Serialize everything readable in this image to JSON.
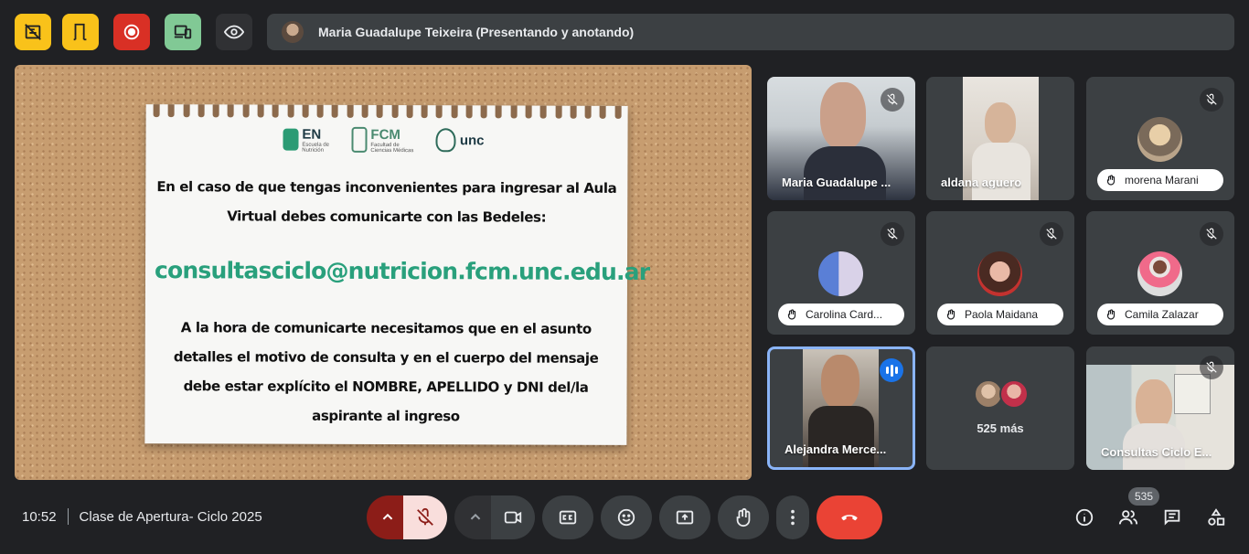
{
  "topbar": {
    "presenter_label": "Maria Guadalupe Teixeira (Presentando y anotando)",
    "buttons": [
      {
        "icon": "hide-annotations-icon",
        "color": "#f9c21a"
      },
      {
        "icon": "door-exit-icon",
        "color": "#f9c21a"
      },
      {
        "icon": "stop-recording-icon",
        "color": "#d93025"
      },
      {
        "icon": "devices-icon",
        "color": "#81c995"
      },
      {
        "icon": "eye-icon",
        "color": "#303134"
      }
    ]
  },
  "slide": {
    "logos": {
      "en": "EN",
      "en_sub": "Escuela de Nutrición",
      "fcm": "FCM",
      "fcm_sub": "Facultad de Ciencias Médicas",
      "unc": "unc"
    },
    "paragraph1": "En el caso de que tengas inconvenientes para ingresar al Aula Virtual debes comunicarte con las Bedeles:",
    "email": "consultasciclo@nutricion.fcm.unc.edu.ar",
    "paragraph2": "A la hora de comunicarte necesitamos que en el asunto detalles el motivo de consulta y en el cuerpo del mensaje debe estar explícito el NOMBRE, APELLIDO y DNI del/la aspirante al ingreso",
    "colors": {
      "cork": "#c79d70",
      "email": "#29a07c"
    }
  },
  "participants": [
    {
      "name": "Maria Guadalupe ...",
      "muted": true,
      "style": "video"
    },
    {
      "name": "aldana aguero",
      "muted": false,
      "style": "video"
    },
    {
      "name": "morena Marani",
      "muted": true,
      "style": "avatar"
    },
    {
      "name": "Carolina Card...",
      "muted": true,
      "style": "avatar"
    },
    {
      "name": "Paola Maidana",
      "muted": true,
      "style": "avatar"
    },
    {
      "name": "Camila Zalazar",
      "muted": true,
      "style": "avatar"
    },
    {
      "name": "Alejandra Merce...",
      "muted": false,
      "speaking": true,
      "style": "video"
    },
    {
      "name": "525 más",
      "style": "overflow"
    },
    {
      "name": "Consultas Ciclo E...",
      "muted": true,
      "style": "video"
    }
  ],
  "bottombar": {
    "time": "10:52",
    "meeting_title": "Clase de Apertura- Ciclo 2025",
    "people_count": "535",
    "controls": [
      "mic-options-chevron-icon",
      "mic-off-icon",
      "camera-options-chevron-icon",
      "camera-icon",
      "captions-icon",
      "emoji-icon",
      "present-screen-icon",
      "raise-hand-icon",
      "more-options-icon",
      "leave-call-icon"
    ],
    "right_icons": [
      "info-icon",
      "people-icon",
      "chat-icon",
      "activities-icon"
    ],
    "colors": {
      "leave": "#ea4335",
      "mic_off_bg": "#f9dedc",
      "mic_chevron_bg": "#8c1d18"
    }
  }
}
